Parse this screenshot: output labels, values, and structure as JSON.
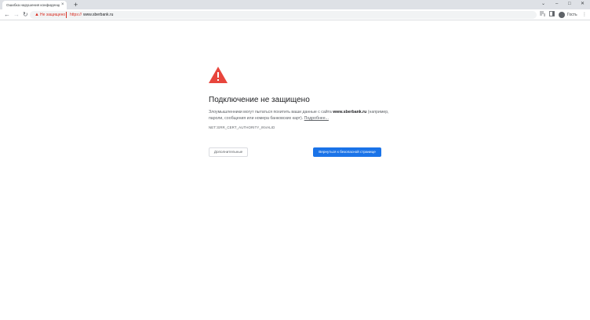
{
  "browser": {
    "tab": {
      "title": "Ошибка нарушения конфиденциальности",
      "close_glyph": "×"
    },
    "new_tab_glyph": "+",
    "window_controls": {
      "dropdown": "⌄",
      "minimize": "–",
      "maximize": "□",
      "close": "✕"
    },
    "nav": {
      "back": "←",
      "forward": "→",
      "reload": "↻"
    },
    "omnibox": {
      "security_label": "Не защищено",
      "url_scheme": "https://",
      "url_host": "www.sberbank.ru"
    },
    "profile": {
      "label": "Гость"
    }
  },
  "interstitial": {
    "heading": "Подключение не защищено",
    "desc_before": "Злоумышленники могут пытаться похитить ваши данные с сайта ",
    "desc_host": "www.sberbank.ru",
    "desc_after": " (например, пароли, сообщения или номера банковских карт). ",
    "learn_more": "Подробнее...",
    "error_code": "NET::ERR_CERT_AUTHORITY_INVALID",
    "advanced_button": "Дополнительные",
    "back_button": "Вернуться к безопасной странице"
  },
  "colors": {
    "warning_red": "#e8453c",
    "primary_blue": "#1a73e8",
    "insecure_red": "#d93025"
  }
}
